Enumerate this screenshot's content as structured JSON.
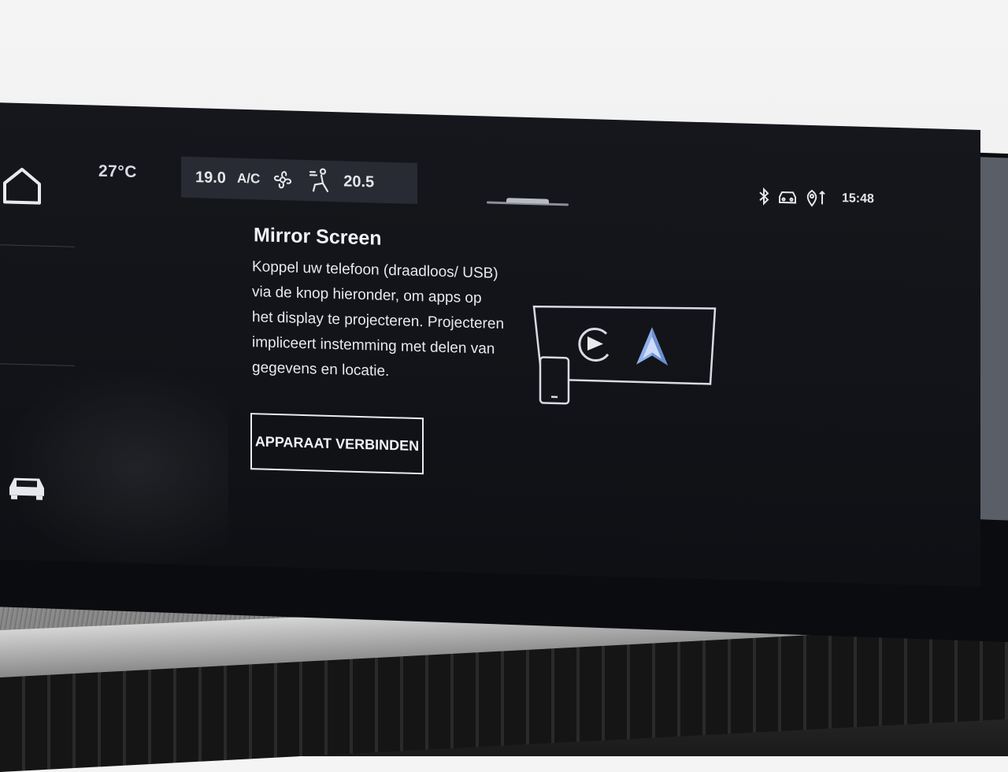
{
  "status_bar": {
    "outside_temp": "27°C",
    "climate": {
      "left_temp": "19.0",
      "ac_label": "A/C",
      "right_temp": "20.5",
      "fan_icon": "fan-icon",
      "airflow_icon": "seat-airflow-icon"
    },
    "icons": [
      "bluetooth-icon",
      "connected-car-icon",
      "location-icon"
    ],
    "time": "15:48"
  },
  "sidebar": {
    "items": [
      {
        "icon": "home-icon"
      },
      {
        "icon": "car-icon"
      }
    ]
  },
  "mirror_screen": {
    "title": "Mirror Screen",
    "description": "Koppel uw telefoon (draadloos/ USB) via de knop hieronder, om apps op het display te projecteren. Projecteren impliceert instemming met delen van gegevens en locatie.",
    "button_label": "APPARAAT VERBINDEN",
    "illustration_icons": [
      "phone-icon",
      "carplay-icon",
      "android-auto-icon"
    ]
  },
  "colors": {
    "screen_bg": "#121419",
    "climate_bg": "#282b33",
    "text": "#e7e9ed"
  }
}
